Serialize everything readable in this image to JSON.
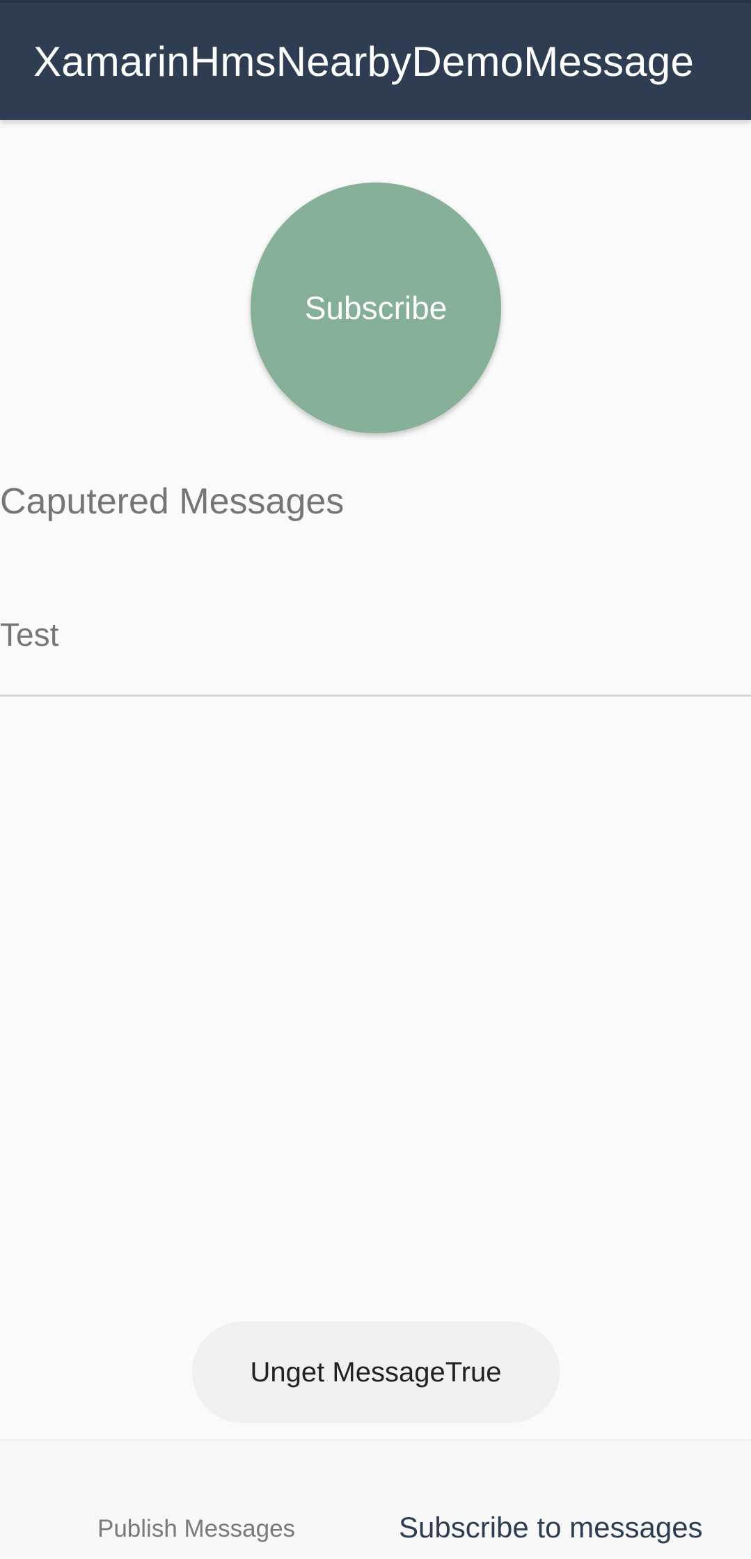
{
  "app_bar": {
    "title": "XamarinHmsNearbyDemoMessage"
  },
  "main": {
    "subscribe_button_label": "Subscribe",
    "captured_heading": "Caputered Messages",
    "messages": [
      {
        "text": "Test"
      }
    ]
  },
  "toast": {
    "text": "Unget MessageTrue"
  },
  "bottom_nav": {
    "tabs": [
      {
        "label": "Publish Messages",
        "selected": false
      },
      {
        "label": "Subscribe to messages",
        "selected": true
      }
    ]
  },
  "colors": {
    "app_bar": "#2e3d51",
    "subscribe_button": "#85af97",
    "background": "#fafafa",
    "selected_tab_text": "#2e3d51",
    "unselected_tab_text": "#7a7a7a"
  }
}
